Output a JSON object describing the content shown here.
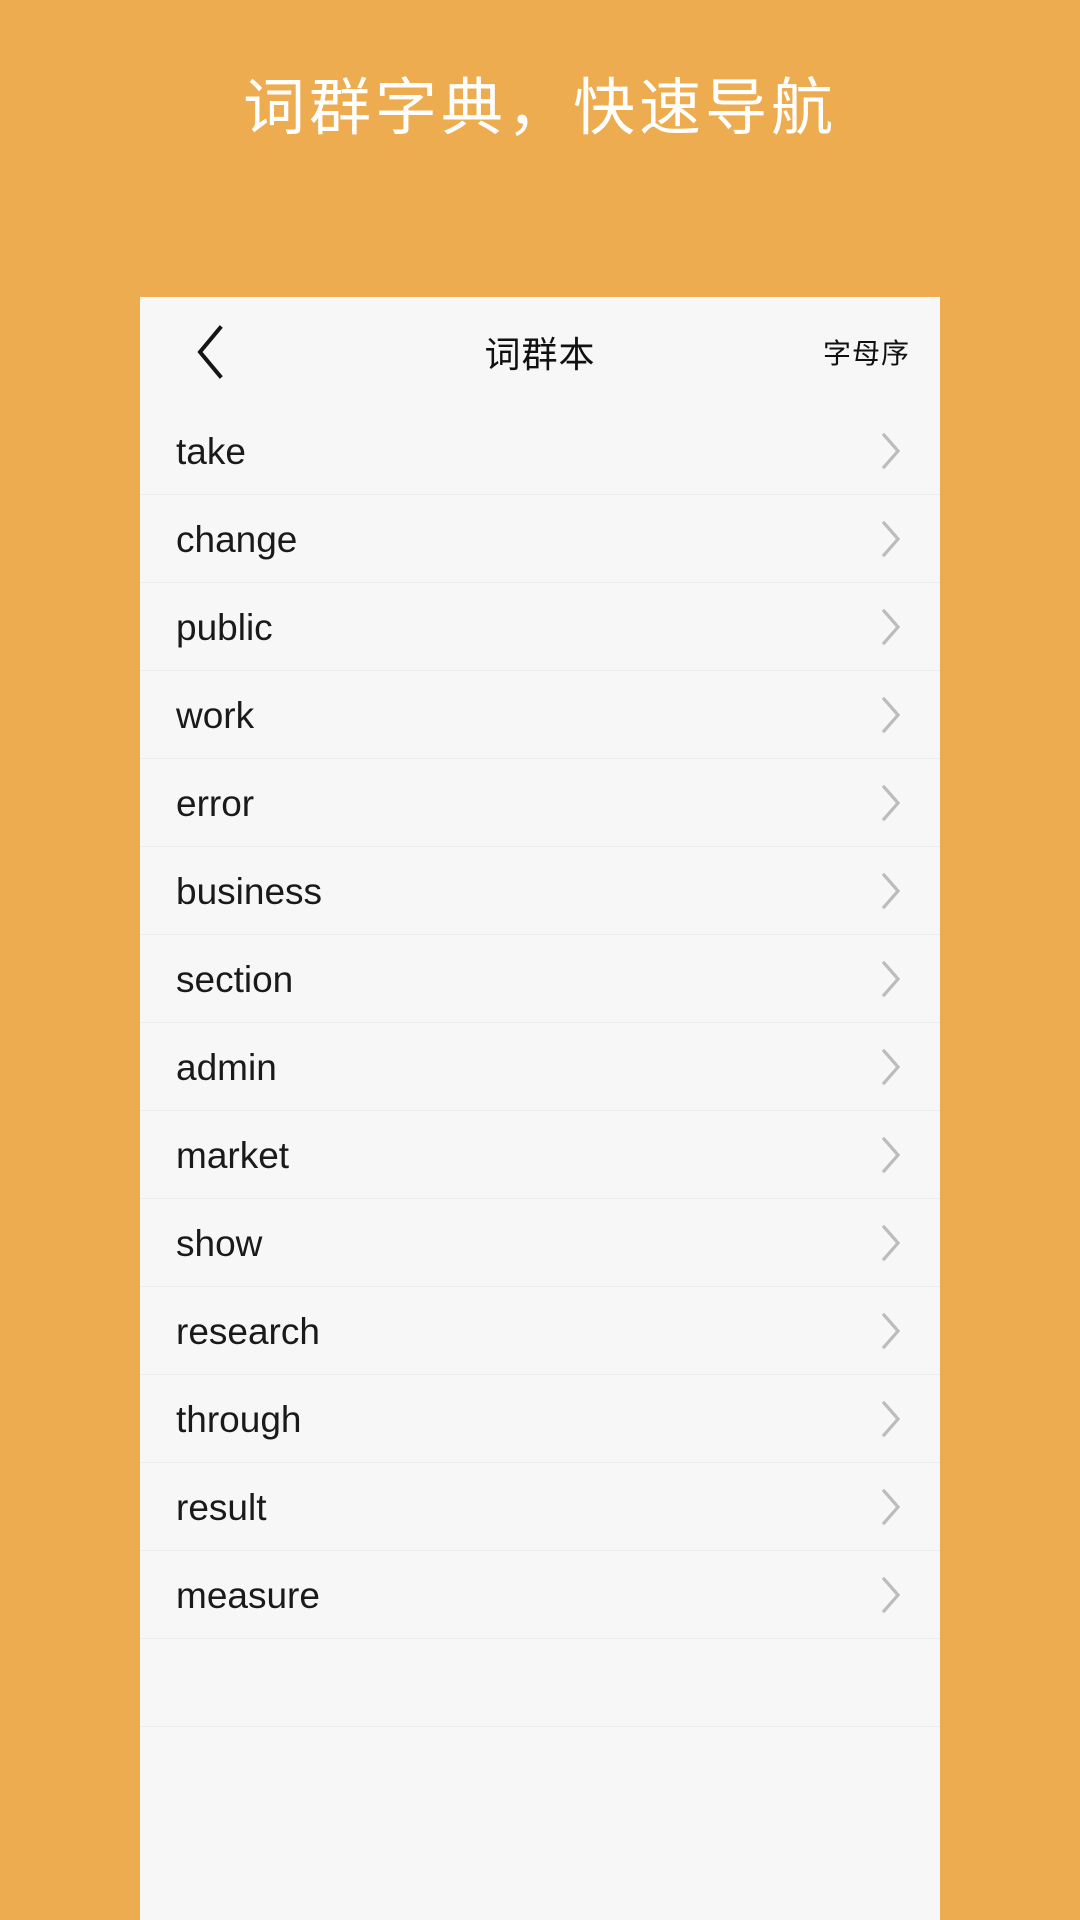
{
  "promo": {
    "headline": "词群字典，快速导航",
    "background_color": "#eeac50",
    "text_color": "#ffffff"
  },
  "screen": {
    "background_color": "#f7f7f7",
    "divider_color": "#ececec",
    "chevron_color": "#bcbcbc"
  },
  "nav": {
    "back_icon": "chevron-left-icon",
    "title": "词群本",
    "action_label": "字母序"
  },
  "list": {
    "chevron_icon": "chevron-right-icon",
    "items": [
      {
        "word": "take"
      },
      {
        "word": "change"
      },
      {
        "word": "public"
      },
      {
        "word": "work"
      },
      {
        "word": "error"
      },
      {
        "word": "business"
      },
      {
        "word": "section"
      },
      {
        "word": "admin"
      },
      {
        "word": "market"
      },
      {
        "word": "show"
      },
      {
        "word": "research"
      },
      {
        "word": "through"
      },
      {
        "word": "result"
      },
      {
        "word": "measure"
      },
      {
        "word": ""
      }
    ]
  }
}
